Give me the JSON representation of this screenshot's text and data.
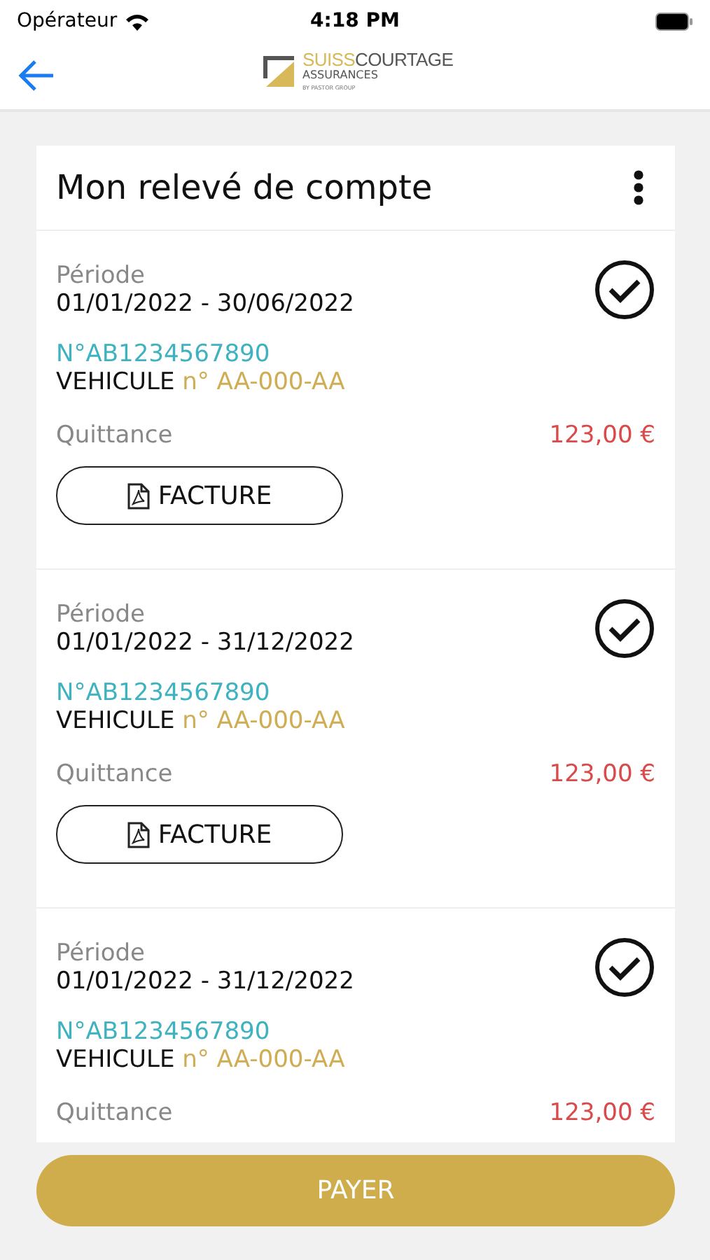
{
  "status_bar": {
    "carrier": "Opérateur",
    "time": "4:18 PM"
  },
  "header": {
    "logo": {
      "brand_light": "SUISS",
      "brand_dark": "COURTAGE",
      "subtitle": "ASSURANCES",
      "tagline": "BY PASTOR GROUP"
    }
  },
  "card": {
    "title": "Mon relevé de compte",
    "items": [
      {
        "period_label": "Période",
        "period": "01/01/2022 - 30/06/2022",
        "checked": true,
        "contract": "N°AB1234567890",
        "vehicle_label": "VEHICULE",
        "vehicle_number": "n° AA-000-AA",
        "receipt_label": "Quittance",
        "amount": "123,00 €",
        "invoice_button": "FACTURE"
      },
      {
        "period_label": "Période",
        "period": "01/01/2022 - 31/12/2022",
        "checked": true,
        "contract": "N°AB1234567890",
        "vehicle_label": "VEHICULE",
        "vehicle_number": "n° AA-000-AA",
        "receipt_label": "Quittance",
        "amount": "123,00 €",
        "invoice_button": "FACTURE"
      },
      {
        "period_label": "Période",
        "period": "01/01/2022 - 31/12/2022",
        "checked": true,
        "contract": "N°AB1234567890",
        "vehicle_label": "VEHICULE",
        "vehicle_number": "n° AA-000-AA",
        "receipt_label": "Quittance",
        "amount": "123,00 €"
      }
    ]
  },
  "pay_button": "PAYER"
}
